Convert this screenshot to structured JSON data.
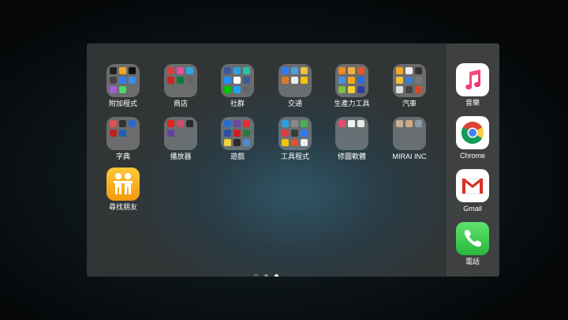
{
  "grid_apps": [
    {
      "label": "附加程式",
      "kind": "folder",
      "icon": "extras-folder-icon"
    },
    {
      "label": "商店",
      "kind": "folder",
      "icon": "store-folder-icon"
    },
    {
      "label": "社群",
      "kind": "folder",
      "icon": "social-folder-icon"
    },
    {
      "label": "交通",
      "kind": "folder",
      "icon": "transport-folder-icon"
    },
    {
      "label": "生產力工具",
      "kind": "folder",
      "icon": "productivity-folder-icon"
    },
    {
      "label": "汽車",
      "kind": "folder",
      "icon": "car-folder-icon"
    },
    {
      "label": "字典",
      "kind": "folder",
      "icon": "dictionary-folder-icon"
    },
    {
      "label": "播放器",
      "kind": "folder",
      "icon": "player-folder-icon"
    },
    {
      "label": "遊戲",
      "kind": "folder",
      "icon": "games-folder-icon"
    },
    {
      "label": "工具程式",
      "kind": "folder",
      "icon": "utilities-folder-icon"
    },
    {
      "label": "修圖軟體",
      "kind": "folder",
      "icon": "photo-edit-folder-icon"
    },
    {
      "label": "MIRAI INC",
      "kind": "folder",
      "icon": "mirai-folder-icon"
    },
    {
      "label": "尋找朋友",
      "kind": "app",
      "icon": "find-friends-icon"
    }
  ],
  "dock_apps": [
    {
      "label": "音樂",
      "icon": "music-icon"
    },
    {
      "label": "Chrome",
      "icon": "chrome-icon"
    },
    {
      "label": "Gmail",
      "icon": "gmail-icon"
    },
    {
      "label": "電話",
      "icon": "phone-icon"
    }
  ],
  "page_indicator": {
    "pages": 2,
    "current": 2,
    "has_search_page": true
  },
  "colors": {
    "folder_tile": "#9a9a9a",
    "find_friends_bg": "#f5a623",
    "music_note": "#fa3c5a",
    "phone_bg": "#34c759",
    "gmail_red": "#d93025",
    "label_text": "#ffffff"
  }
}
